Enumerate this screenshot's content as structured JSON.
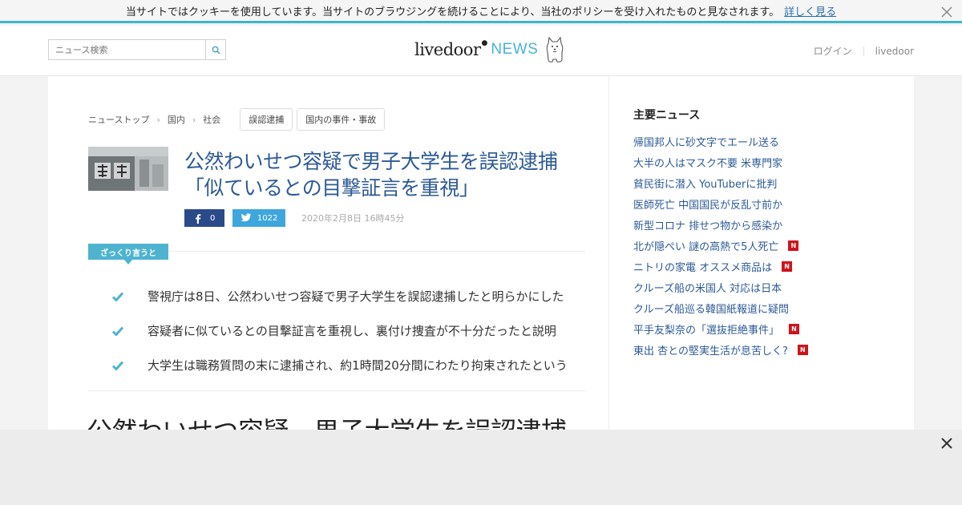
{
  "cookie_bar": {
    "message": "当サイトではクッキーを使用しています。当サイトのブラウジングを続けることにより、当社のポリシーを受け入れたものと見なされます。",
    "link": "詳しく見る"
  },
  "header": {
    "search_placeholder": "ニュース検索",
    "logo_livedoor": "livedoor",
    "logo_news": "NEWS",
    "login": "ログイン",
    "livedoor_link": "livedoor"
  },
  "breadcrumb": {
    "items": [
      "ニューストップ",
      "国内",
      "社会"
    ],
    "tags": [
      "誤認逮捕",
      "国内の事件・事故"
    ]
  },
  "article": {
    "headline": "公然わいせつ容疑で男子大学生を誤認逮捕「似ているとの目撃証言を重視」",
    "fb_count": "0",
    "tw_count": "1022",
    "date": "2020年2月8日 16時45分",
    "summary_label": "ざっくり言うと",
    "summary": [
      "警視庁は8日、公然わいせつ容疑で男子大学生を誤認逮捕したと明らかにした",
      "容疑者に似ているとの目撃証言を重視し、裏付け捜査が不十分だったと説明",
      "大学生は職務質問の末に逮捕され、約1時間20分間にわたり拘束されたという"
    ],
    "body_title": "公然わいせつ容疑　男子大学生を誤認逮捕"
  },
  "sidebar": {
    "heading": "主要ニュース",
    "news": [
      {
        "title": "帰国邦人に砂文字でエール送る",
        "new": false
      },
      {
        "title": "大半の人はマスク不要 米専門家",
        "new": false
      },
      {
        "title": "貧民街に潜入 YouTuberに批判",
        "new": false
      },
      {
        "title": "医師死亡 中国国民が反乱寸前か",
        "new": false
      },
      {
        "title": "新型コロナ 排せつ物から感染か",
        "new": false
      },
      {
        "title": "北が隠ぺい 謎の高熱で5人死亡",
        "new": true
      },
      {
        "title": "ニトリの家電 オススメ商品は",
        "new": true
      },
      {
        "title": "クルーズ船の米国人 対応は日本",
        "new": false
      },
      {
        "title": "クルーズ船巡る韓国紙報道に疑問",
        "new": false
      },
      {
        "title": "平手友梨奈の「選抜拒絶事件」",
        "new": true
      },
      {
        "title": "東出 杏との堅実生活が息苦しく?",
        "new": true
      }
    ],
    "new_badge": "N"
  },
  "colors": {
    "accent": "#3fb5c8",
    "link": "#2d5a96",
    "facebook": "#2b4a8a",
    "twitter": "#3ea6dd",
    "new_badge": "#d0121b"
  }
}
